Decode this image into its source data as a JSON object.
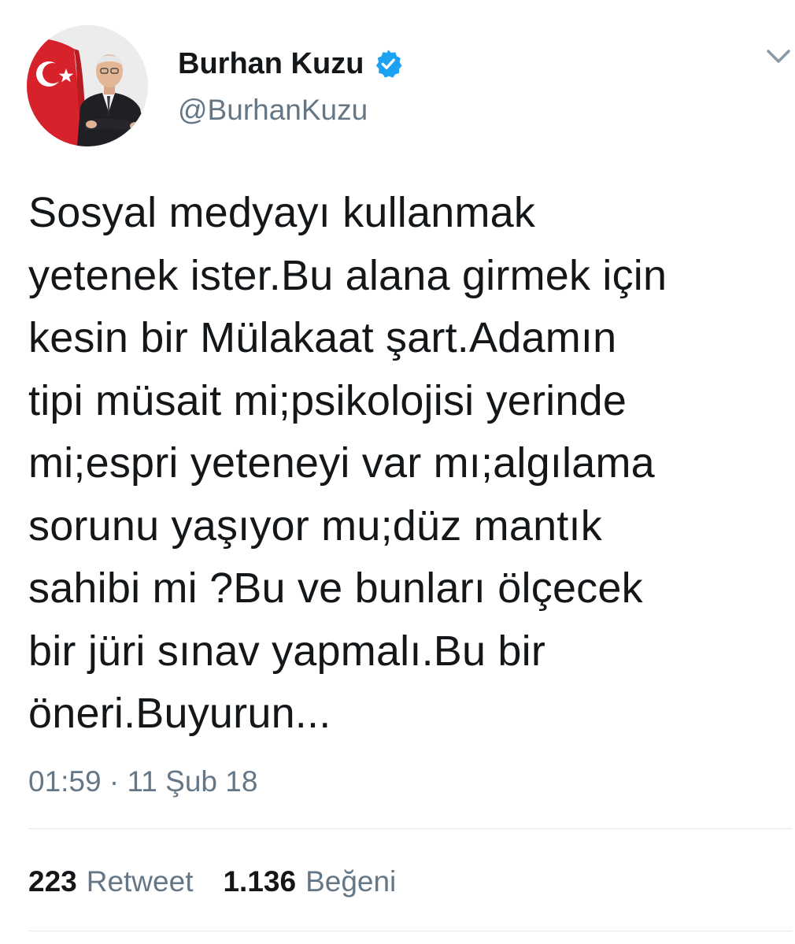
{
  "author": {
    "display_name": "Burhan Kuzu",
    "handle": "@BurhanKuzu",
    "verified": true,
    "avatar_icon": "profile-photo-with-flag",
    "verified_color": "#1da1f2"
  },
  "tweet": {
    "text": "Sosyal medyayı kullanmak\nyetenek ister.Bu alana girmek için\nkesin bir Mülakaat şart.Adamın\ntipi müsait mi;psikolojisi yerinde\nmi;espri yeteneyi  var mı;algılama\nsorunu yaşıyor mu;düz mantık\nsahibi mi ?Bu ve bunları ölçecek\nbir jüri sınav yapmalı.Bu bir\nöneri.Buyurun...",
    "timestamp": "01:59 · 11 Şub 18"
  },
  "stats": {
    "retweet_count": "223",
    "retweet_label": "Retweet",
    "like_count": "1.136",
    "like_label": "Beğeni"
  },
  "menu": {
    "icon": "chevron-down-icon"
  }
}
